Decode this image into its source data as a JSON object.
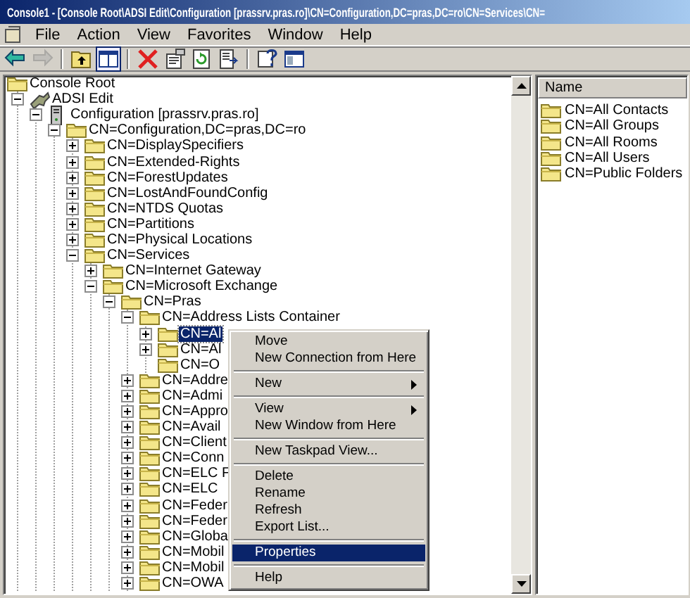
{
  "window": {
    "title": "Console1 - [Console Root\\ADSI Edit\\Configuration [prassrv.pras.ro]\\CN=Configuration,DC=pras,DC=ro\\CN=Services\\CN="
  },
  "menu_bar": [
    "File",
    "Action",
    "View",
    "Favorites",
    "Window",
    "Help"
  ],
  "toolbar": [
    {
      "kind": "back",
      "disabled": false,
      "pressed": false
    },
    {
      "kind": "forward",
      "disabled": true,
      "pressed": false
    },
    {
      "kind": "separator"
    },
    {
      "kind": "up",
      "disabled": false,
      "pressed": false
    },
    {
      "kind": "tree",
      "disabled": false,
      "pressed": true
    },
    {
      "kind": "separator"
    },
    {
      "kind": "delete",
      "disabled": false,
      "pressed": false
    },
    {
      "kind": "properties",
      "disabled": false,
      "pressed": false
    },
    {
      "kind": "refresh",
      "disabled": false,
      "pressed": false
    },
    {
      "kind": "export",
      "disabled": false,
      "pressed": false
    },
    {
      "kind": "separator"
    },
    {
      "kind": "help",
      "disabled": false,
      "pressed": false
    },
    {
      "kind": "pane",
      "disabled": false,
      "pressed": false
    }
  ],
  "tree": [
    {
      "label": "Console Root",
      "kind": "folder",
      "selected": false,
      "children": [
        {
          "label": "ADSI Edit",
          "kind": "tool",
          "expanded": true,
          "selected": false,
          "children": [
            {
              "label": "Configuration [prassrv.pras.ro]",
              "kind": "server",
              "expanded": true,
              "selected": false,
              "children": [
                {
                  "label": "CN=Configuration,DC=pras,DC=ro",
                  "kind": "folder",
                  "expanded": true,
                  "selected": false,
                  "children": [
                    {
                      "label": "CN=DisplaySpecifiers",
                      "kind": "folder",
                      "expanded": false,
                      "selected": false
                    },
                    {
                      "label": "CN=Extended-Rights",
                      "kind": "folder",
                      "expanded": false,
                      "selected": false
                    },
                    {
                      "label": "CN=ForestUpdates",
                      "kind": "folder",
                      "expanded": false,
                      "selected": false
                    },
                    {
                      "label": "CN=LostAndFoundConfig",
                      "kind": "folder",
                      "expanded": false,
                      "selected": false
                    },
                    {
                      "label": "CN=NTDS Quotas",
                      "kind": "folder",
                      "expanded": false,
                      "selected": false
                    },
                    {
                      "label": "CN=Partitions",
                      "kind": "folder",
                      "expanded": false,
                      "selected": false
                    },
                    {
                      "label": "CN=Physical Locations",
                      "kind": "folder",
                      "expanded": false,
                      "selected": false
                    },
                    {
                      "label": "CN=Services",
                      "kind": "folder",
                      "expanded": true,
                      "selected": false,
                      "children": [
                        {
                          "label": "CN=Internet Gateway",
                          "kind": "folder",
                          "expanded": false,
                          "selected": false
                        },
                        {
                          "label": "CN=Microsoft Exchange",
                          "kind": "folder",
                          "expanded": true,
                          "selected": false,
                          "children": [
                            {
                              "label": "CN=Pras",
                              "kind": "folder",
                              "expanded": true,
                              "selected": false,
                              "children": [
                                {
                                  "label": "CN=Address Lists Container",
                                  "kind": "folder",
                                  "expanded": true,
                                  "selected": false,
                                  "children": [
                                    {
                                      "label": "CN=Al",
                                      "kind": "folder",
                                      "expanded": false,
                                      "selected": true
                                    },
                                    {
                                      "label": "CN=Al",
                                      "kind": "folder",
                                      "expanded": false,
                                      "selected": false
                                    },
                                    {
                                      "label": "CN=O",
                                      "kind": "folder",
                                      "selected": false
                                    }
                                  ]
                                },
                                {
                                  "label": "CN=Addre",
                                  "kind": "folder",
                                  "expanded": false,
                                  "selected": false
                                },
                                {
                                  "label": "CN=Admi",
                                  "kind": "folder",
                                  "expanded": false,
                                  "selected": false
                                },
                                {
                                  "label": "CN=Appro",
                                  "kind": "folder",
                                  "expanded": false,
                                  "selected": false
                                },
                                {
                                  "label": "CN=Avail",
                                  "kind": "folder",
                                  "expanded": false,
                                  "selected": false
                                },
                                {
                                  "label": "CN=Client",
                                  "kind": "folder",
                                  "expanded": false,
                                  "selected": false
                                },
                                {
                                  "label": "CN=Conn",
                                  "kind": "folder",
                                  "expanded": false,
                                  "selected": false
                                },
                                {
                                  "label": "CN=ELC F",
                                  "kind": "folder",
                                  "expanded": false,
                                  "selected": false
                                },
                                {
                                  "label": "CN=ELC",
                                  "kind": "folder",
                                  "expanded": false,
                                  "selected": false
                                },
                                {
                                  "label": "CN=Feder",
                                  "kind": "folder",
                                  "expanded": false,
                                  "selected": false
                                },
                                {
                                  "label": "CN=Feder",
                                  "kind": "folder",
                                  "expanded": false,
                                  "selected": false
                                },
                                {
                                  "label": "CN=Globa",
                                  "kind": "folder",
                                  "expanded": false,
                                  "selected": false
                                },
                                {
                                  "label": "CN=Mobil",
                                  "kind": "folder",
                                  "expanded": false,
                                  "selected": false
                                },
                                {
                                  "label": "CN=Mobil",
                                  "kind": "folder",
                                  "expanded": false,
                                  "selected": false
                                },
                                {
                                  "label": "CN=OWA",
                                  "kind": "folder",
                                  "expanded": false,
                                  "selected": false
                                }
                              ]
                            }
                          ]
                        }
                      ]
                    }
                  ]
                }
              ]
            }
          ]
        }
      ]
    }
  ],
  "list": {
    "column": "Name",
    "items": [
      "CN=All Contacts",
      "CN=All Groups",
      "CN=All Rooms",
      "CN=All Users",
      "CN=Public Folders"
    ]
  },
  "context_menu": [
    {
      "kind": "item",
      "label": "Move",
      "submenu": false,
      "selected": false
    },
    {
      "kind": "item",
      "label": "New Connection from Here",
      "submenu": false,
      "selected": false
    },
    {
      "kind": "separator"
    },
    {
      "kind": "item",
      "label": "New",
      "submenu": true,
      "selected": false
    },
    {
      "kind": "separator"
    },
    {
      "kind": "item",
      "label": "View",
      "submenu": true,
      "selected": false
    },
    {
      "kind": "item",
      "label": "New Window from Here",
      "submenu": false,
      "selected": false
    },
    {
      "kind": "separator"
    },
    {
      "kind": "item",
      "label": "New Taskpad View...",
      "submenu": false,
      "selected": false
    },
    {
      "kind": "separator"
    },
    {
      "kind": "item",
      "label": "Delete",
      "submenu": false,
      "selected": false
    },
    {
      "kind": "item",
      "label": "Rename",
      "submenu": false,
      "selected": false
    },
    {
      "kind": "item",
      "label": "Refresh",
      "submenu": false,
      "selected": false
    },
    {
      "kind": "item",
      "label": "Export List...",
      "submenu": false,
      "selected": false
    },
    {
      "kind": "separator"
    },
    {
      "kind": "item",
      "label": "Properties",
      "submenu": false,
      "selected": true
    },
    {
      "kind": "separator"
    },
    {
      "kind": "item",
      "label": "Help",
      "submenu": false,
      "selected": false
    }
  ]
}
